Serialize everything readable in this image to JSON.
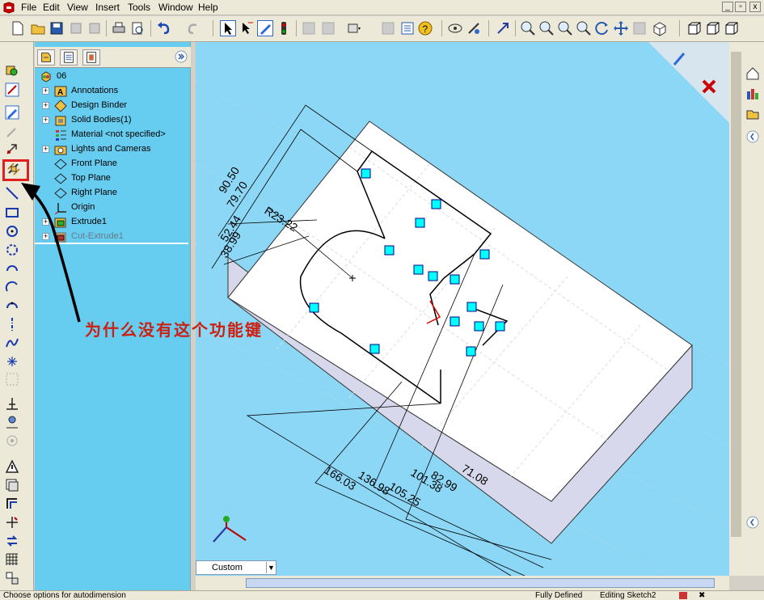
{
  "menubar": {
    "items": [
      "File",
      "Edit",
      "View",
      "Insert",
      "Tools",
      "Window",
      "Help"
    ],
    "window_controls": [
      "_",
      "▫",
      "x"
    ]
  },
  "feature_tree": {
    "root": "06",
    "items": [
      {
        "label": "Annotations",
        "expandable": true,
        "icon": "annotations-icon"
      },
      {
        "label": "Design Binder",
        "expandable": true,
        "icon": "design-binder-icon"
      },
      {
        "label": "Solid Bodies(1)",
        "expandable": true,
        "icon": "solid-bodies-icon"
      },
      {
        "label": "Material <not specified>",
        "expandable": false,
        "icon": "material-icon"
      },
      {
        "label": "Lights and Cameras",
        "expandable": true,
        "icon": "lights-cameras-icon"
      },
      {
        "label": "Front Plane",
        "expandable": false,
        "icon": "plane-icon"
      },
      {
        "label": "Top Plane",
        "expandable": false,
        "icon": "plane-icon"
      },
      {
        "label": "Right Plane",
        "expandable": false,
        "icon": "plane-icon"
      },
      {
        "label": "Origin",
        "expandable": false,
        "icon": "origin-icon"
      },
      {
        "label": "Extrude1",
        "expandable": true,
        "icon": "extrude-icon"
      },
      {
        "label": "Cut-Extrude1",
        "expandable": true,
        "icon": "cut-extrude-icon",
        "greyed": true
      }
    ]
  },
  "dimensions": {
    "d1": "90.50",
    "d2": "79.70",
    "d3": "52.44",
    "d4": "38.99",
    "r1": "R23.22",
    "b1": "166.03",
    "b2": "136.98",
    "b3": "105.25",
    "b4": "101.38",
    "b5": "82.99",
    "b6": "71.08"
  },
  "annotation_text": "为什么没有这个功能键",
  "view_dropdown": {
    "value": "Custom"
  },
  "statusbar": {
    "hint": "Choose options for autodimension",
    "state": "Fully Defined",
    "mode": "Editing Sketch2"
  },
  "colors": {
    "viewport_bg": "#8cd7f5",
    "sketch_line": "#000000",
    "relation_badge": "#00ffff",
    "annotation_red": "#cc2010",
    "highlight_box": "#e02020"
  }
}
